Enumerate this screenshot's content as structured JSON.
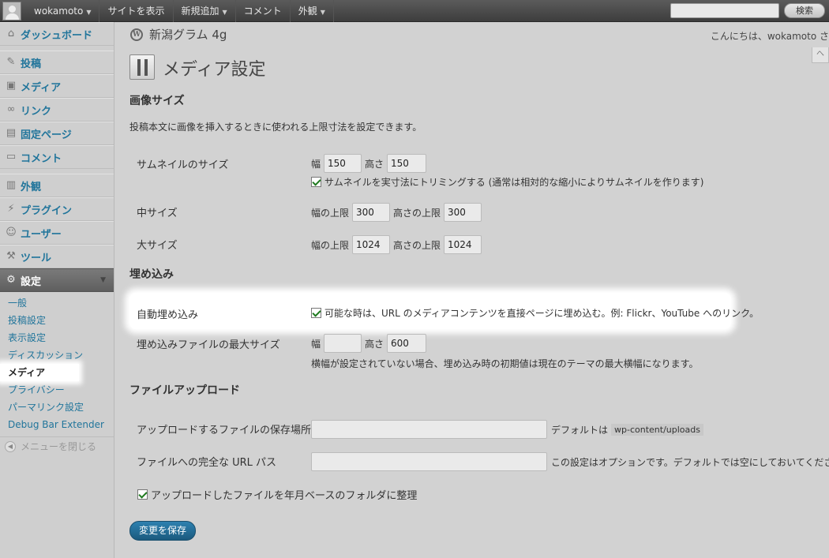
{
  "adminbar": {
    "user": "wokamoto",
    "items": [
      "サイトを表示",
      "新規追加",
      "コメント",
      "外観"
    ],
    "search_button": "検索"
  },
  "sidebar": {
    "dashboard": "ダッシュボード",
    "posts": "投稿",
    "media": "メディア",
    "links": "リンク",
    "pages": "固定ページ",
    "comments": "コメント",
    "appearance": "外観",
    "plugins": "プラグイン",
    "users": "ユーザー",
    "tools": "ツール",
    "settings": "設定",
    "submenu": [
      "一般",
      "投稿設定",
      "表示設定",
      "ディスカッション",
      "メディア",
      "プライバシー",
      "パーマリンク設定",
      "Debug Bar Extender"
    ],
    "collapse": "メニューを閉じる"
  },
  "header": {
    "site_title": "新潟グラム 4g",
    "howdy": "こんにちは、wokamoto さ"
  },
  "page": {
    "title": "メディア設定",
    "image_sizes": {
      "heading": "画像サイズ",
      "description": "投稿本文に画像を挿入するときに使われる上限寸法を設定できます。",
      "thumbnail_label": "サムネイルのサイズ",
      "width_label": "幅",
      "height_label": "高さ",
      "thumb_w": "150",
      "thumb_h": "150",
      "crop_label": "サムネイルを実寸法にトリミングする (通常は相対的な縮小によりサムネイルを作ります)",
      "medium_label": "中サイズ",
      "max_width_label": "幅の上限",
      "max_height_label": "高さの上限",
      "medium_w": "300",
      "medium_h": "300",
      "large_label": "大サイズ",
      "large_w": "1024",
      "large_h": "1024"
    },
    "embeds": {
      "heading": "埋め込み",
      "auto_label": "自動埋め込み",
      "auto_desc": "可能な時は、URL のメディアコンテンツを直接ページに埋め込む。例: Flickr、YouTube へのリンク。",
      "max_label": "埋め込みファイルの最大サイズ",
      "width_label": "幅",
      "height_label": "高さ",
      "max_w": "",
      "max_h": "600",
      "note": "横幅が設定されていない場合、埋め込み時の初期値は現在のテーマの最大横幅になります。"
    },
    "uploads": {
      "heading": "ファイルアップロード",
      "path_label": "アップロードするファイルの保存場所",
      "path_default_prefix": "デフォルトは",
      "path_default_code": "wp-content/uploads",
      "url_label": "ファイルへの完全な URL パス",
      "url_note": "この設定はオプションです。デフォルトでは空にしておいてください。",
      "yearmonth_label": "アップロードしたファイルを年月ベースのフォルダに整理"
    },
    "save_button": "変更を保存"
  }
}
